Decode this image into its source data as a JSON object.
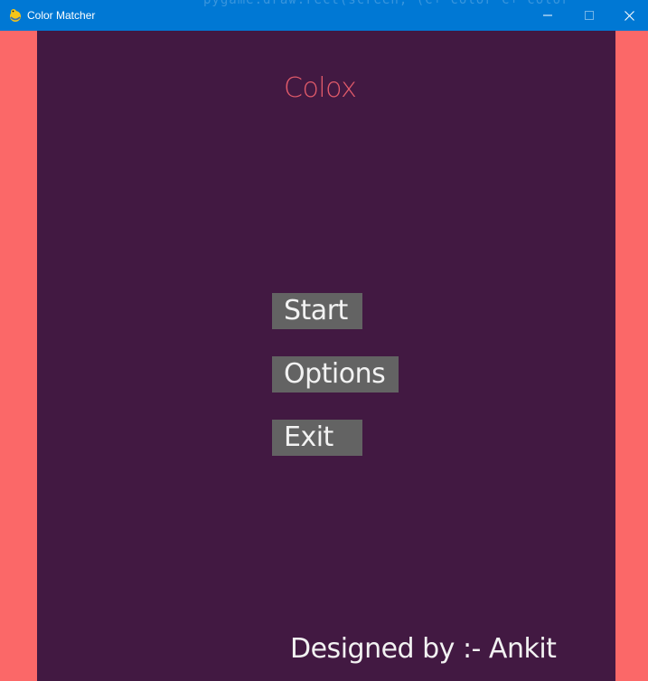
{
  "window": {
    "title": "Color Matcher",
    "background_code_text": "pygame.draw.rect(screen, (C+ color C+ color",
    "titlebar_color": "#0078d4",
    "icons": {
      "app": "pygame-snake-icon",
      "minimize": "minimize-icon",
      "maximize": "maximize-icon",
      "close": "close-icon"
    }
  },
  "game": {
    "title": "Colox",
    "colors": {
      "border": "#fb6868",
      "panel": "#421942",
      "title": "#e05a6a",
      "button_bg": "#636363",
      "button_text": "#f2f2f2"
    },
    "menu": {
      "start_label": "Start",
      "options_label": "Options",
      "exit_label": "Exit"
    },
    "credit": "Designed by :- Ankit"
  }
}
